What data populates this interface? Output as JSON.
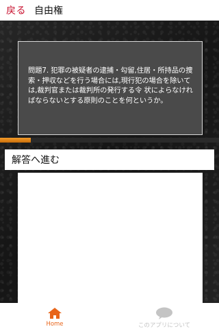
{
  "header": {
    "back_label": "戻る",
    "title": "自由権"
  },
  "question": {
    "text": "問題7. 犯罪の被疑者の逮捕・勾留,住居・所持品の捜索・押収などを行う場合には,現行犯の場合を除いては,裁判官または裁判所の発行する令 状によらなければならないとする原則のことを何というか。"
  },
  "progress": {
    "value": 0.14,
    "color": "#e8851a"
  },
  "answer_button": {
    "label": "解答へ進む"
  },
  "tabs": [
    {
      "label": "Home",
      "icon": "home-icon",
      "active": true,
      "color": "#e8651a"
    },
    {
      "label": "このアプリについて",
      "icon": "speech-bubble-icon",
      "active": false,
      "color": "#c4c4c4"
    }
  ]
}
